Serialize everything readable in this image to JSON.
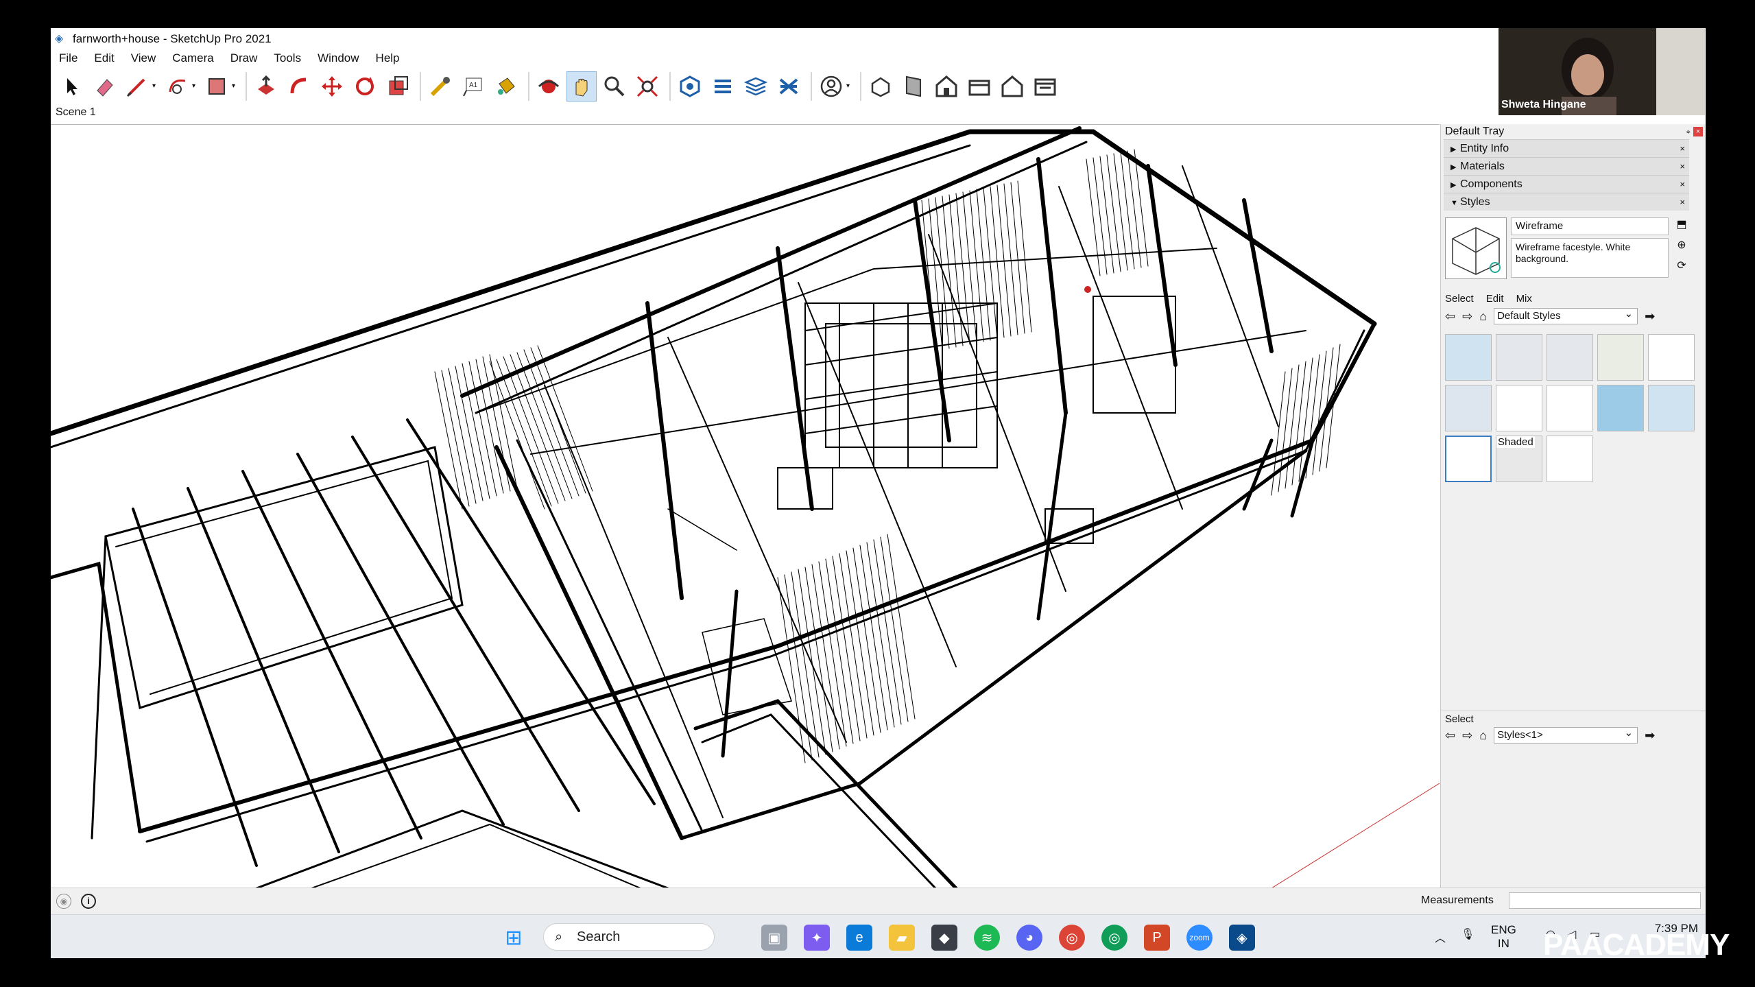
{
  "window": {
    "title": "farnworth+house - SketchUp Pro 2021"
  },
  "menu": [
    "File",
    "Edit",
    "View",
    "Camera",
    "Draw",
    "Tools",
    "Window",
    "Help"
  ],
  "scene_tab": "Scene 1",
  "tray": {
    "title": "Default Tray",
    "panels": [
      {
        "label": "Entity Info",
        "expanded": false
      },
      {
        "label": "Materials",
        "expanded": false
      },
      {
        "label": "Components",
        "expanded": false
      },
      {
        "label": "Styles",
        "expanded": true
      }
    ],
    "styles": {
      "name": "Wireframe",
      "description": "Wireframe facestyle.  White background.",
      "tabs": [
        "Select",
        "Edit",
        "Mix"
      ],
      "collection": "Default Styles",
      "hover_label": "Shaded",
      "select_label": "Select",
      "model_styles": "Styles<1>"
    }
  },
  "status": {
    "measurements_label": "Measurements"
  },
  "taskbar": {
    "search_placeholder": "Search",
    "lang_top": "ENG",
    "lang_bottom": "IN",
    "time": "7:39 PM"
  },
  "webcam": {
    "participant": "Shweta Hingane"
  },
  "watermark": "PAACADEMY"
}
